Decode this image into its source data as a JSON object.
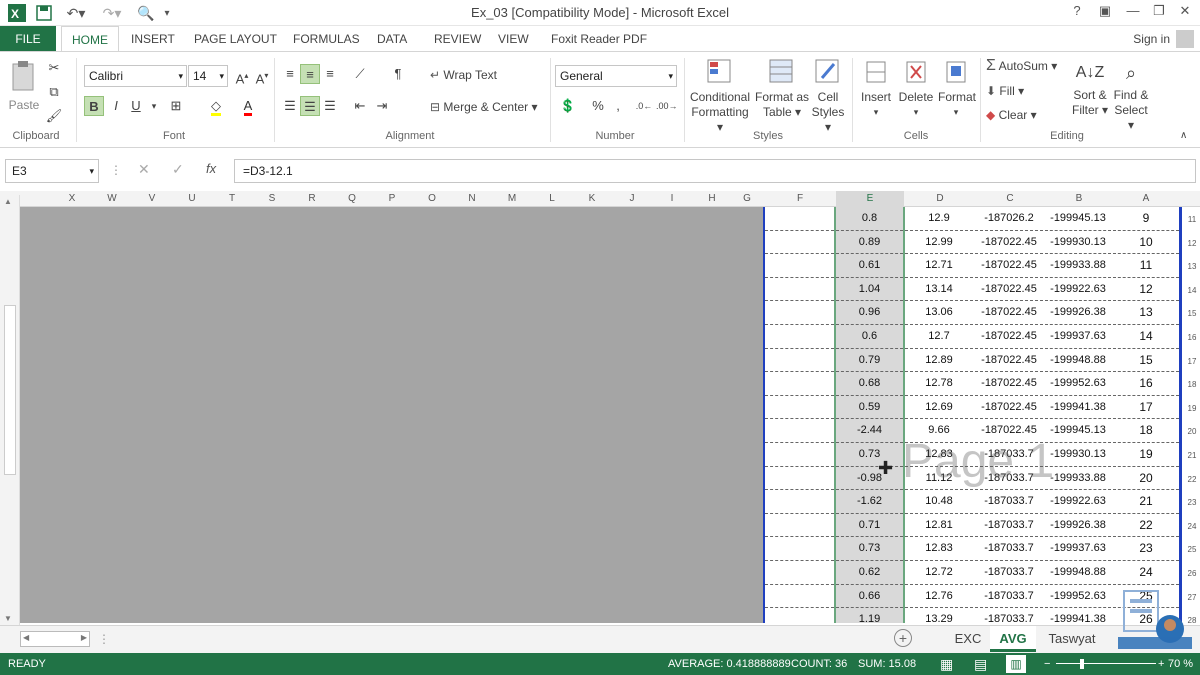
{
  "window": {
    "title": "Ex_03  [Compatibility Mode] - Microsoft Excel",
    "help_glyph": "?",
    "minimize_glyph": "—",
    "restore_glyph": "❐",
    "close_glyph": "✕"
  },
  "ribbon_tabs": [
    "FILE",
    "HOME",
    "INSERT",
    "PAGE LAYOUT",
    "FORMULAS",
    "DATA",
    "REVIEW",
    "VIEW",
    "Foxit Reader PDF"
  ],
  "sign_in": "Sign in",
  "clipboard": {
    "paste": "Paste",
    "label": "Clipboard"
  },
  "font": {
    "name": "Calibri",
    "size": "14",
    "label": "Font",
    "bold": "B",
    "italic": "I",
    "underline": "U"
  },
  "alignment": {
    "wrap": "Wrap Text",
    "merge": "Merge & Center",
    "label": "Alignment"
  },
  "number": {
    "format": "General",
    "label": "Number",
    "percent": "%",
    "comma": ","
  },
  "styles": {
    "conditional": "Conditional",
    "formatting": "Formatting",
    "format_as": "Format as",
    "table": "Table",
    "cell": "Cell",
    "cell_styles": "Styles",
    "label": "Styles"
  },
  "cells": {
    "insert": "Insert",
    "delete": "Delete",
    "format": "Format",
    "label": "Cells"
  },
  "editing": {
    "autosum": "AutoSum",
    "fill": "Fill",
    "clear": "Clear",
    "sort": "Sort &",
    "filter": "Filter",
    "find": "Find &",
    "select": "Select",
    "label": "Editing"
  },
  "formula_bar": {
    "name_box": "E3",
    "fx": "fx",
    "formula": "=D3-12.1"
  },
  "columns": [
    "X",
    "W",
    "V",
    "U",
    "T",
    "S",
    "R",
    "Q",
    "P",
    "O",
    "N",
    "M",
    "L",
    "K",
    "J",
    "I",
    "H",
    "G",
    "F",
    "E",
    "D",
    "C",
    "B",
    "A"
  ],
  "rows": [
    {
      "rownum": "11",
      "E": "0.8",
      "D": "12.9",
      "C": "-187026.2",
      "B": "-199945.13",
      "A": "9"
    },
    {
      "rownum": "12",
      "E": "0.89",
      "D": "12.99",
      "C": "-187022.45",
      "B": "-199930.13",
      "A": "10"
    },
    {
      "rownum": "13",
      "E": "0.61",
      "D": "12.71",
      "C": "-187022.45",
      "B": "-199933.88",
      "A": "11"
    },
    {
      "rownum": "14",
      "E": "1.04",
      "D": "13.14",
      "C": "-187022.45",
      "B": "-199922.63",
      "A": "12"
    },
    {
      "rownum": "15",
      "E": "0.96",
      "D": "13.06",
      "C": "-187022.45",
      "B": "-199926.38",
      "A": "13"
    },
    {
      "rownum": "16",
      "E": "0.6",
      "D": "12.7",
      "C": "-187022.45",
      "B": "-199937.63",
      "A": "14"
    },
    {
      "rownum": "17",
      "E": "0.79",
      "D": "12.89",
      "C": "-187022.45",
      "B": "-199948.88",
      "A": "15"
    },
    {
      "rownum": "18",
      "E": "0.68",
      "D": "12.78",
      "C": "-187022.45",
      "B": "-199952.63",
      "A": "16"
    },
    {
      "rownum": "19",
      "E": "0.59",
      "D": "12.69",
      "C": "-187022.45",
      "B": "-199941.38",
      "A": "17"
    },
    {
      "rownum": "20",
      "E": "-2.44",
      "D": "9.66",
      "C": "-187022.45",
      "B": "-199945.13",
      "A": "18"
    },
    {
      "rownum": "21",
      "E": "0.73",
      "D": "12.83",
      "C": "-187033.7",
      "B": "-199930.13",
      "A": "19"
    },
    {
      "rownum": "22",
      "E": "-0.98",
      "D": "11.12",
      "C": "-187033.7",
      "B": "-199933.88",
      "A": "20"
    },
    {
      "rownum": "23",
      "E": "-1.62",
      "D": "10.48",
      "C": "-187033.7",
      "B": "-199922.63",
      "A": "21"
    },
    {
      "rownum": "24",
      "E": "0.71",
      "D": "12.81",
      "C": "-187033.7",
      "B": "-199926.38",
      "A": "22"
    },
    {
      "rownum": "25",
      "E": "0.73",
      "D": "12.83",
      "C": "-187033.7",
      "B": "-199937.63",
      "A": "23"
    },
    {
      "rownum": "26",
      "E": "0.62",
      "D": "12.72",
      "C": "-187033.7",
      "B": "-199948.88",
      "A": "24"
    },
    {
      "rownum": "27",
      "E": "0.66",
      "D": "12.76",
      "C": "-187033.7",
      "B": "-199952.63",
      "A": "25"
    },
    {
      "rownum": "28",
      "E": "1.19",
      "D": "13.29",
      "C": "-187033.7",
      "B": "-199941.38",
      "A": "26"
    }
  ],
  "page_watermark": "Page 1",
  "sheet_tabs": [
    "EXC",
    "AVG",
    "Taswyat"
  ],
  "active_sheet": "AVG",
  "status": {
    "ready": "READY",
    "average": "AVERAGE: 0.418888889",
    "count": "COUNT: 36",
    "sum": "SUM: 15.08",
    "zoom": "70 %"
  },
  "accent": "#217346"
}
